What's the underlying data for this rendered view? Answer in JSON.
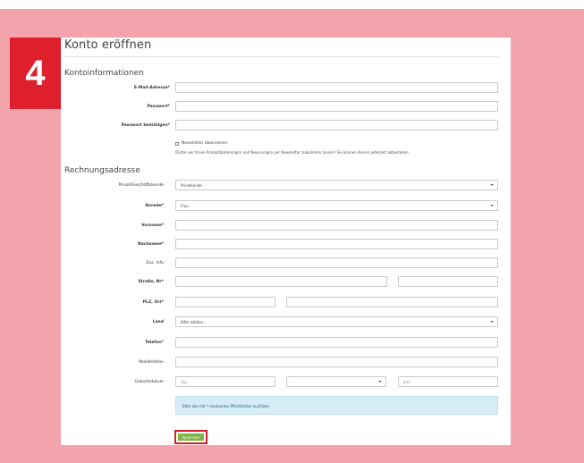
{
  "step": {
    "number": "4"
  },
  "page": {
    "title": "Konto eröffnen"
  },
  "sections": {
    "account": "Kontoinformationen",
    "billing": "Rechnungsadresse"
  },
  "account": {
    "email_label": "E-Mail-Adresse*",
    "password_label": "Passwort*",
    "password_confirm_label": "Passwort bestätigen*",
    "newsletter_label": "Newsletter abonnieren",
    "newsletter_note": "Dürfen wir Ihnen Produktänderungen und Neuerungen per Newsletter zukommen lassen? Sie können diesen jederzeit abbestellen."
  },
  "billing": {
    "customer_type_label": "Privat/Geschäftskunde",
    "customer_type_value": "Privatkunde",
    "salutation_label": "Anrede*",
    "salutation_value": "Frau",
    "firstname_label": "Vorname*",
    "lastname_label": "Nachname*",
    "additional_label": "Zus. Info",
    "street_label": "Straße, Nr*",
    "zip_city_label": "PLZ, Ort*",
    "country_label": "Land",
    "country_value": "Bitte wählen...",
    "phone_label": "Telefon*",
    "mobile_label": "Mobiltelefon",
    "birthdate_label": "Geburtsdatum",
    "day_placeholder": "Tag",
    "month_value": "-",
    "year_placeholder": "Jahr"
  },
  "info": {
    "message": "Bitte alle mit * markierten Pflichtfelder ausfüllen"
  },
  "actions": {
    "save_label": "Speichern"
  },
  "colors": {
    "accent": "#e01f2d",
    "save": "#7cb342",
    "info_bg": "#d6ecf6",
    "backdrop": "#f2a3ab"
  }
}
